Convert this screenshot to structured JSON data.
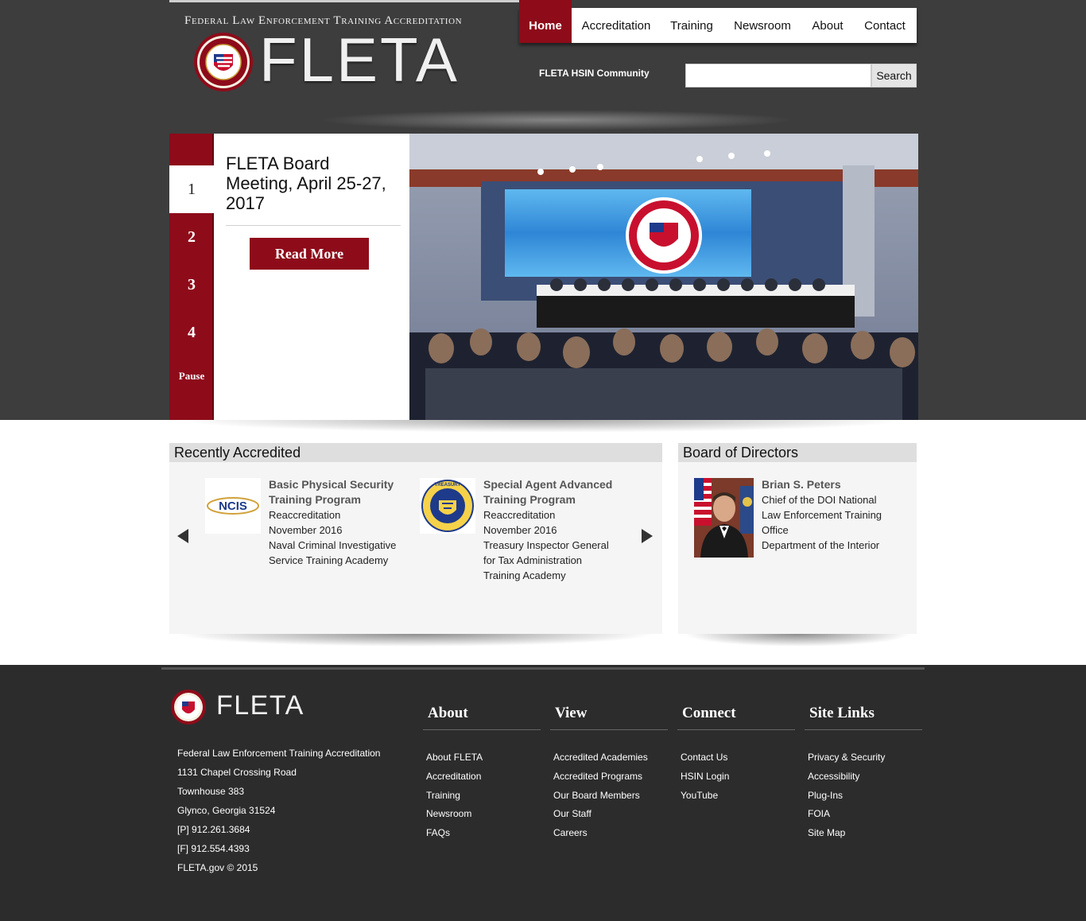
{
  "header": {
    "tagline": "Federal Law Enforcement Training Accreditation",
    "brand": "FLETA",
    "hsin_link": "FLETA HSIN Community",
    "search_placeholder": "",
    "search_button": "Search"
  },
  "nav": {
    "items": [
      {
        "label": "Home",
        "active": true
      },
      {
        "label": "Accreditation"
      },
      {
        "label": "Training"
      },
      {
        "label": "Newsroom"
      },
      {
        "label": "About"
      },
      {
        "label": "Contact"
      }
    ]
  },
  "slider": {
    "numbers": [
      "1",
      "2",
      "3",
      "4"
    ],
    "active_index": 0,
    "pause_label": "Pause",
    "title": "FLETA Board Meeting, April 25-27, 2017",
    "read_more": "Read More"
  },
  "recently_accredited": {
    "heading": "Recently Accredited",
    "cards": [
      {
        "title": "Basic Physical Security Training Program",
        "type": "Reaccreditation",
        "date": "November 2016",
        "academy": "Naval Criminal Investigative Service Training Academy",
        "logo_text": "NCIS"
      },
      {
        "title": "Special Agent Advanced Training Program",
        "type": "Reaccreditation",
        "date": "November 2016",
        "academy": "Treasury Inspector General for Tax Administration Training Academy",
        "logo_text": "TREASURY"
      }
    ]
  },
  "board": {
    "heading": "Board of Directors",
    "name": "Brian S. Peters",
    "role": "Chief of the DOI National Law Enforcement Training Office",
    "dept": "Department of the Interior"
  },
  "footer": {
    "brand": "FLETA",
    "address": [
      "Federal Law Enforcement Training Accreditation",
      "1131 Chapel Crossing Road",
      "Townhouse 383",
      "Glynco, Georgia 31524",
      "[P] 912.261.3684",
      "[F] 912.554.4393",
      "FLETA.gov © 2015"
    ],
    "columns": [
      {
        "heading": "About",
        "links": [
          "About FLETA",
          "Accreditation",
          "Training",
          "Newsroom",
          "FAQs"
        ]
      },
      {
        "heading": "View",
        "links": [
          "Accredited Academies",
          "Accredited Programs",
          "Our Board Members",
          "Our Staff",
          "Careers"
        ]
      },
      {
        "heading": "Connect",
        "links": [
          "Contact Us",
          "HSIN Login",
          "YouTube"
        ]
      },
      {
        "heading": "Site Links",
        "links": [
          "Privacy & Security",
          "Accessibility",
          "Plug-Ins",
          "FOIA",
          "Site Map"
        ]
      }
    ]
  },
  "colors": {
    "brand_red": "#8e0b1a",
    "header_bg": "#3d3d3d",
    "footer_bg": "#2c2c2c"
  }
}
